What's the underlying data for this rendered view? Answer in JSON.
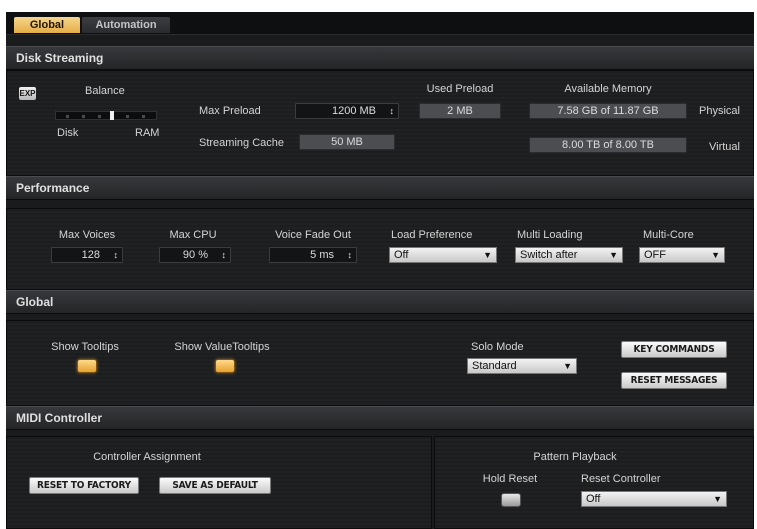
{
  "tabs": [
    {
      "label": "Global",
      "active": true
    },
    {
      "label": "Automation",
      "active": false
    }
  ],
  "disk_streaming": {
    "header": "Disk Streaming",
    "exp_label": "EXP",
    "balance_label": "Balance",
    "balance_value_fraction": 0.55,
    "disk_label": "Disk",
    "ram_label": "RAM",
    "max_preload_label": "Max Preload",
    "max_preload_value": "1200 MB",
    "streaming_cache_label": "Streaming Cache",
    "streaming_cache_value": "50 MB",
    "used_preload_label": "Used Preload",
    "used_preload_value": "2 MB",
    "available_memory_label": "Available Memory",
    "physical_value": "7.58 GB of 11.87 GB",
    "physical_label": "Physical",
    "virtual_value": "8.00 TB of 8.00 TB",
    "virtual_label": "Virtual"
  },
  "performance": {
    "header": "Performance",
    "max_voices_label": "Max Voices",
    "max_voices_value": "128",
    "max_cpu_label": "Max CPU",
    "max_cpu_value": "90 %",
    "voice_fade_out_label": "Voice Fade Out",
    "voice_fade_out_value": "5 ms",
    "load_preference_label": "Load Preference",
    "load_preference_value": "Off",
    "multi_loading_label": "Multi Loading",
    "multi_loading_value": "Switch after",
    "multi_core_label": "Multi-Core",
    "multi_core_value": "OFF"
  },
  "global": {
    "header": "Global",
    "show_tooltips_label": "Show Tooltips",
    "show_tooltips_on": true,
    "show_value_tooltips_label": "Show ValueTooltips",
    "show_value_tooltips_on": true,
    "solo_mode_label": "Solo Mode",
    "solo_mode_value": "Standard",
    "key_commands_label": "KEY COMMANDS",
    "reset_messages_label": "RESET MESSAGES"
  },
  "midi_controller": {
    "header": "MIDI Controller",
    "controller_assignment_label": "Controller Assignment",
    "reset_to_factory_label": "RESET TO FACTORY",
    "save_as_default_label": "SAVE AS DEFAULT",
    "pattern_playback_label": "Pattern Playback",
    "hold_reset_label": "Hold Reset",
    "hold_reset_on": false,
    "reset_controller_label": "Reset Controller",
    "reset_controller_value": "Off"
  },
  "icons": {
    "spin": "up-down-arrows-icon",
    "dropdown": "triangle-down-icon"
  },
  "colors": {
    "accent": "#e8ad4a",
    "background": "#1a1b1d"
  }
}
